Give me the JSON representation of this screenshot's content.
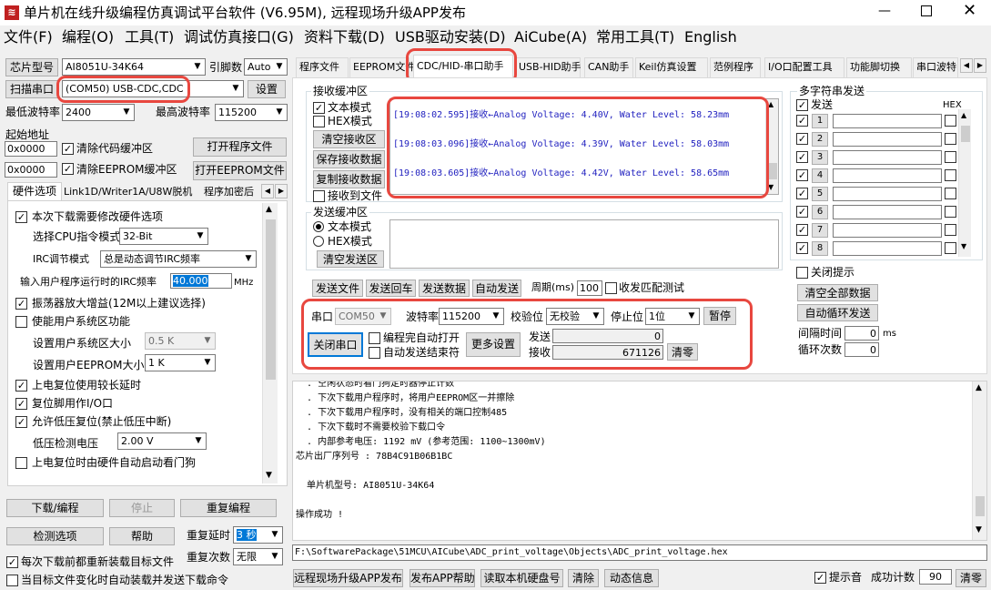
{
  "title": "单片机在线升级编程仿真调试平台软件 (V6.95M), 远程现场升级APP发布",
  "menu": [
    "文件(F)",
    "编程(O)",
    "工具(T)",
    "调试仿真接口(G)",
    "资料下载(D)",
    "USB驱动安装(D)",
    "AiCube(A)",
    "常用工具(T)",
    "English"
  ],
  "left": {
    "chip_label": "芯片型号",
    "chip_value": "AI8051U-34K64",
    "pins_label": "引脚数",
    "pins_value": "Auto",
    "scan_label": "扫描串口",
    "port_value": "(COM50) USB-CDC,CDC",
    "settings_label": "设置",
    "min_baud_label": "最低波特率",
    "min_baud": "2400",
    "max_baud_label": "最高波特率",
    "max_baud": "115200",
    "start_addr_label": "起始地址",
    "addr1": "0x0000",
    "addr2": "0x0000",
    "clear_code": "清除代码缓冲区",
    "clear_eeprom": "清除EEPROM缓冲区",
    "open_prog": "打开程序文件",
    "open_eeprom": "打开EEPROM文件",
    "tabs": [
      "硬件选项",
      "Link1D/Writer1A/U8W脱机",
      "程序加密后"
    ],
    "opt_modify": "本次下载需要修改硬件选项",
    "cpu_label": "选择CPU指令模式",
    "cpu_value": "32-Bit",
    "irc_label": "IRC调节模式",
    "irc_value": "总是动态调节IRC频率",
    "freq_label": "输入用户程序运行时的IRC频率",
    "freq_value": "40.000",
    "freq_unit": "MHz",
    "osc": "振荡器放大增益(12M以上建议选择)",
    "sys_area": "使能用户系统区功能",
    "sys_size_label": "设置用户系统区大小",
    "sys_size_value": "0.5 K",
    "eeprom_size_label": "设置用户EEPROM大小",
    "eeprom_size_value": "1   K",
    "delay": "上电复位使用较长延时",
    "reset_io": "复位脚用作I/O口",
    "lvr": "允许低压复位(禁止低压中断)",
    "lvd_label": "低压检测电压",
    "lvd_value": "2.00 V",
    "wdt": "上电复位时由硬件自动启动看门狗",
    "download": "下载/编程",
    "stop": "停止",
    "reprogram": "重复编程",
    "detect": "检测选项",
    "help": "帮助",
    "delay_label": "重复延时",
    "delay_value": "3 秒",
    "reload": "每次下载前都重新装载目标文件",
    "count_label": "重复次数",
    "count_value": "无限",
    "auto_reload": "当目标文件变化时自动装载并发送下载命令"
  },
  "tabs": [
    "程序文件",
    "EEPROM文件",
    "CDC/HID-串口助手",
    "USB-HID助手",
    "CAN助手",
    "Keil仿真设置",
    "范例程序",
    "I/O口配置工具",
    "功能脚切换",
    "串口波特"
  ],
  "recv": {
    "group": "接收缓冲区",
    "text_mode": "文本模式",
    "hex_mode": "HEX模式",
    "clear": "清空接收区",
    "save": "保存接收数据",
    "copy": "复制接收数据",
    "to_file": "接收到文件",
    "lines": [
      "[19:08:02.595]接收←Analog Voltage: 4.40V, Water Level: 58.23mm",
      "[19:08:03.096]接收←Analog Voltage: 4.39V, Water Level: 58.03mm",
      "[19:08:03.605]接收←Analog Voltage: 4.42V, Water Level: 58.65mm"
    ]
  },
  "send": {
    "group": "发送缓冲区",
    "text_mode": "文本模式",
    "hex_mode": "HEX模式",
    "clear": "清空发送区",
    "send_file": "发送文件",
    "send_enter": "发送回车",
    "send_data": "发送数据",
    "auto_send": "自动发送",
    "period_label": "周期(ms)",
    "period_value": "100",
    "match": "收发匹配测试"
  },
  "serial": {
    "port_label": "串口",
    "port_value": "COM50",
    "baud_label": "波特率",
    "baud_value": "115200",
    "parity_label": "校验位",
    "parity_value": "无校验",
    "stop_label": "停止位",
    "stop_value": "1位",
    "pause": "暂停",
    "close": "关闭串口",
    "auto_open": "编程完自动打开",
    "auto_end": "自动发送结束符",
    "more": "更多设置",
    "send_label": "发送",
    "send_count": "0",
    "recv_label": "接收",
    "recv_count": "671126",
    "clear": "清零"
  },
  "multi": {
    "title": "多字符串发送",
    "send_col": "发送",
    "hex_col": "HEX",
    "rows": [
      "1",
      "2",
      "3",
      "4",
      "5",
      "6",
      "7",
      "8"
    ],
    "close_hint": "关闭提示",
    "clear_all": "清空全部数据",
    "auto_loop": "自动循环发送",
    "interval_label": "间隔时间",
    "interval_value": "0",
    "interval_unit": "ms",
    "loop_label": "循环次数",
    "loop_value": "0"
  },
  "info_lines": [
    "  . 空闲状态时看门狗定时器停止计数",
    "  . 下次下载用户程序时，将用户EEPROM区一并擦除",
    "  . 下次下载用户程序时，没有相关的端口控制485",
    "  . 下次下载时不需要校验下载口令",
    "  . 内部参考电压: 1192 mV (参考范围: 1100~1300mV)",
    "芯片出厂序列号 : 78B4C91B06B1BC",
    "",
    "  单片机型号: AI8051U-34K64",
    "",
    "操作成功 !"
  ],
  "path": "F:\\SoftwarePackage\\51MCU\\AICube\\ADC_print_voltage\\Objects\\ADC_print_voltage.hex",
  "bottom": {
    "remote": "远程现场升级APP发布",
    "publish_help": "发布APP帮助",
    "read_disk": "读取本机硬盘号",
    "clear": "清除",
    "dynamic": "动态信息",
    "beep": "提示音",
    "success_label": "成功计数",
    "success_value": "90",
    "clear2": "清零"
  },
  "accent": "#e8473f"
}
